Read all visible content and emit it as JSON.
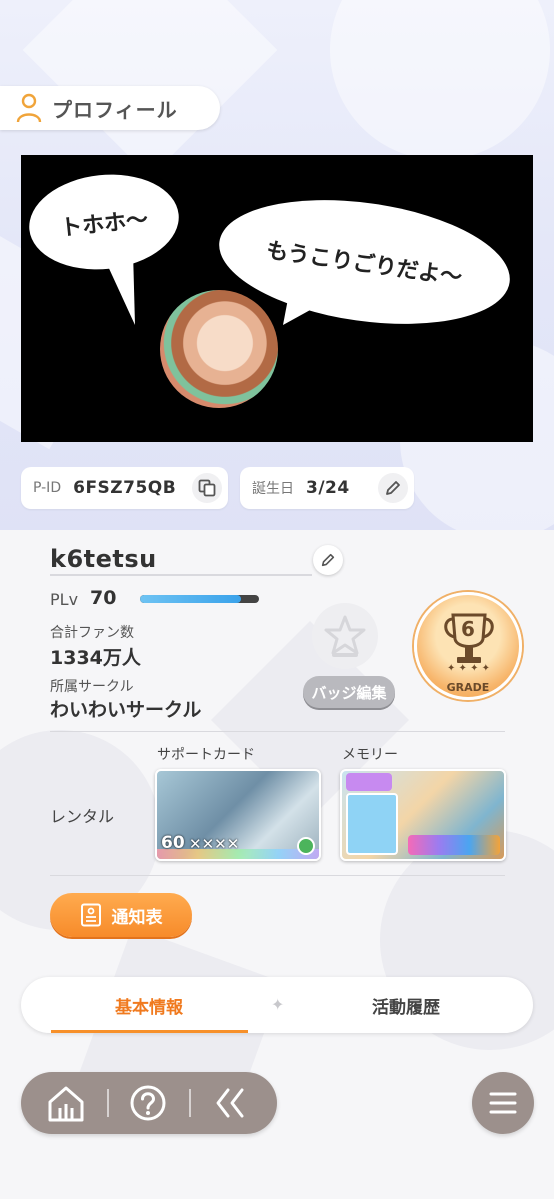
{
  "header": {
    "title": "プロフィール",
    "icon": "person-icon"
  },
  "banner": {
    "bubble_left": "トホホ～",
    "bubble_right": "もうこりごりだよ～"
  },
  "info": {
    "pid_label": "P-ID",
    "pid_value": "6FSZ75QB",
    "birthday_label": "誕生日",
    "birthday_value": "3/24"
  },
  "profile": {
    "username": "k6tetsu",
    "plv_label": "PLv",
    "plv_value": "70",
    "plv_progress": 0.85,
    "fans_label": "合計ファン数",
    "fans_value": "1334万人",
    "circle_label": "所属サークル",
    "circle_value": "わいわいサークル",
    "badge_edit_label": "バッジ編集",
    "grade_number": "6",
    "grade_label": "GRADE"
  },
  "rental": {
    "label": "レンタル",
    "support_card_label": "サポートカード",
    "support_card_level": "60",
    "memory_label": "メモリー"
  },
  "report_button": "通知表",
  "tabs": [
    {
      "label": "基本情報",
      "active": true
    },
    {
      "label": "活動履歴",
      "active": false
    }
  ],
  "colors": {
    "accent_orange": "#f7902a",
    "nav_gray": "#9c908c",
    "plv_bar": "#3aa2ea",
    "grade_gold": "#f7b56b"
  }
}
